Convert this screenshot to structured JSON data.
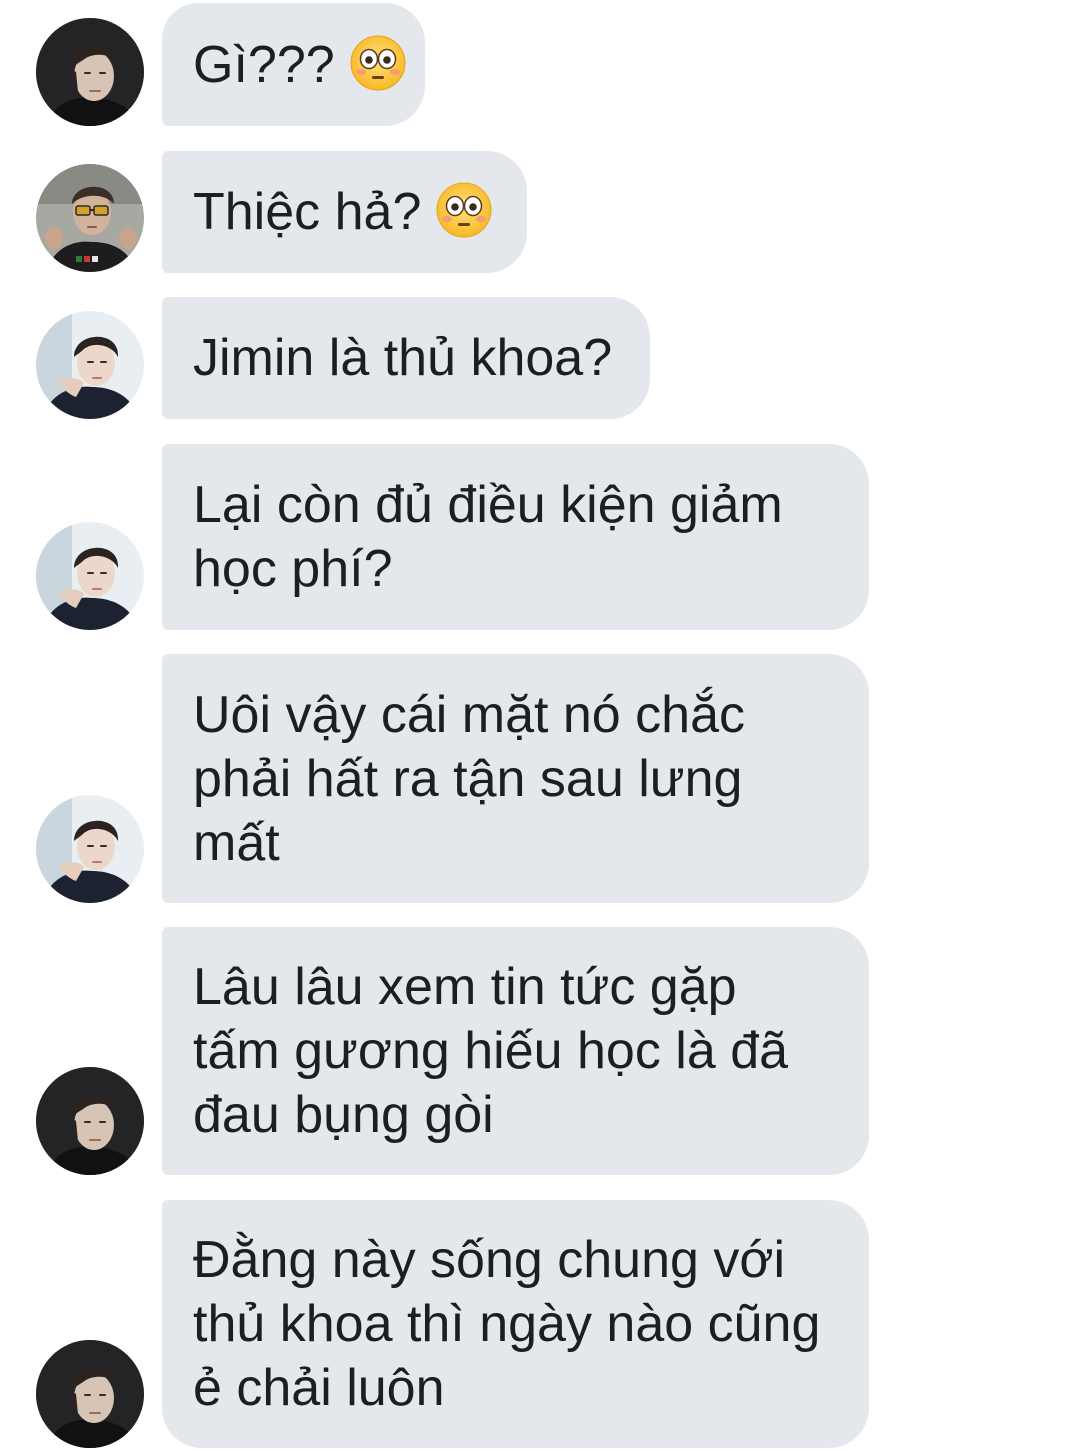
{
  "messages": [
    {
      "lines": [
        "Gì???"
      ],
      "emoji": "flushed-face",
      "avatar": "avatar-dark-portrait"
    },
    {
      "lines": [
        "Thiệc hả?"
      ],
      "emoji": "flushed-face",
      "avatar": "avatar-sunglasses-heart-hands"
    },
    {
      "lines": [
        "Jimin là thủ khoa?"
      ],
      "avatar": "avatar-light-portrait"
    },
    {
      "lines": [
        "Lại còn đủ điều kiện giảm",
        "học phí?"
      ],
      "avatar": "avatar-light-portrait"
    },
    {
      "lines": [
        "Uôi vậy cái mặt nó chắc",
        "phải hất ra tận sau lưng",
        "mất"
      ],
      "avatar": "avatar-light-portrait"
    },
    {
      "lines": [
        "Lâu lâu xem tin tức gặp",
        "tấm gương hiếu học là đã",
        "đau bụng gòi"
      ],
      "avatar": "avatar-dark-portrait"
    },
    {
      "lines": [
        "Đằng này sống chung với",
        "thủ khoa thì ngày nào cũng",
        "ẻ chải luôn"
      ],
      "avatar": "avatar-dark-portrait"
    }
  ],
  "colors": {
    "bubble": "#e4e8ed",
    "text": "#1c1e21",
    "background": "#ffffff"
  }
}
